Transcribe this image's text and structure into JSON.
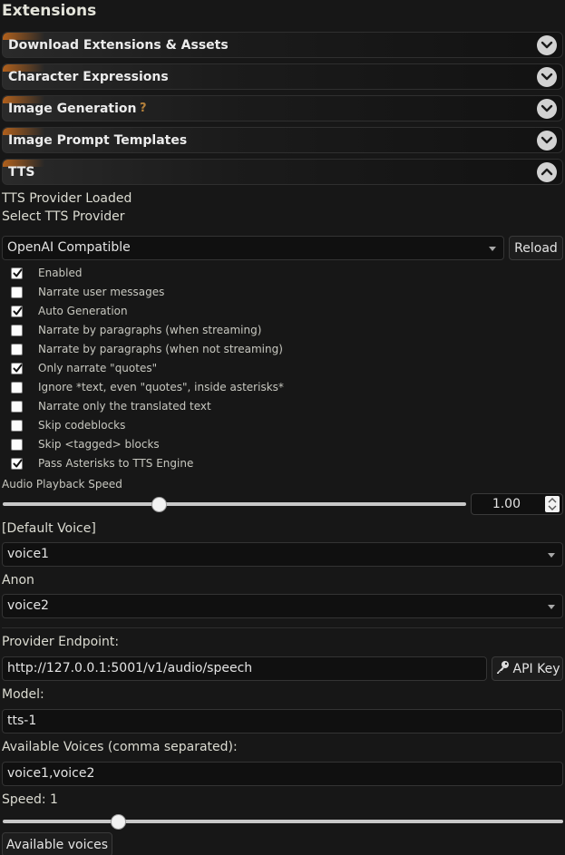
{
  "header": {
    "title": "Extensions"
  },
  "drawers": [
    {
      "label": "Download Extensions & Assets",
      "expanded": false
    },
    {
      "label": "Character Expressions",
      "expanded": false
    },
    {
      "label": "Image Generation",
      "help": "?",
      "expanded": false
    },
    {
      "label": "Image Prompt Templates",
      "expanded": false
    },
    {
      "label": "TTS",
      "expanded": true
    }
  ],
  "tts": {
    "status": "TTS Provider Loaded",
    "provider_label": "Select TTS Provider",
    "provider_value": "OpenAI Compatible",
    "reload_label": "Reload",
    "options": [
      {
        "label": "Enabled",
        "checked": true
      },
      {
        "label": "Narrate user messages",
        "checked": false
      },
      {
        "label": "Auto Generation",
        "checked": true
      },
      {
        "label": "Narrate by paragraphs (when streaming)",
        "checked": false
      },
      {
        "label": "Narrate by paragraphs (when not streaming)",
        "checked": false
      },
      {
        "label": "Only narrate \"quotes\"",
        "checked": true
      },
      {
        "label": "Ignore *text, even \"quotes\", inside asterisks*",
        "checked": false
      },
      {
        "label": "Narrate only the translated text",
        "checked": false
      },
      {
        "label": "Skip codeblocks",
        "checked": false
      },
      {
        "label": "Skip <tagged> blocks",
        "checked": false
      },
      {
        "label": "Pass Asterisks to TTS Engine",
        "checked": true
      }
    ],
    "playback_speed_label": "Audio Playback Speed",
    "playback_speed_value": "1.00",
    "default_voice_label": "[Default Voice]",
    "default_voice_value": "voice1",
    "anon_label": "Anon",
    "anon_voice_value": "voice2",
    "endpoint_label": "Provider Endpoint:",
    "endpoint_value": "http://127.0.0.1:5001/v1/audio/speech",
    "api_key_label": "API Key",
    "model_label": "Model:",
    "model_value": "tts-1",
    "voices_label": "Available Voices (comma separated):",
    "voices_value": "voice1,voice2",
    "speed_label": "Speed: 1",
    "available_voices_button": "Available voices"
  }
}
